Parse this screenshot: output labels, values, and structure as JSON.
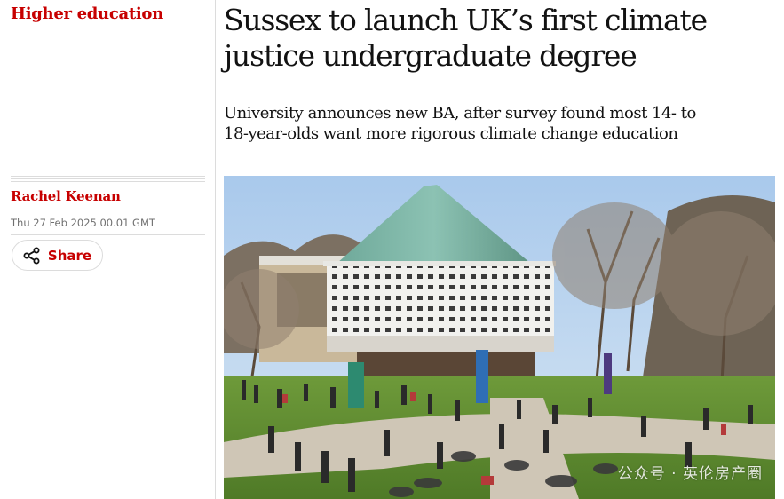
{
  "section": {
    "label": "Higher education"
  },
  "byline": {
    "author": "Rachel Keenan",
    "date": "Thu 27 Feb 2025 00.01 GMT"
  },
  "share": {
    "label": "Share",
    "icon": "share-icon"
  },
  "article": {
    "headline": "Sussex to launch UK’s first climate justice undergraduate degree",
    "standfirst": "University announces new BA, after survey found most 14- to 18-year-olds want more rigorous climate change education"
  },
  "photo": {
    "watermark": "公众号 · 英伦房产圈"
  },
  "colors": {
    "accent": "#c70000",
    "text": "#121212",
    "muted": "#707070",
    "rule": "#dcdcdc"
  }
}
